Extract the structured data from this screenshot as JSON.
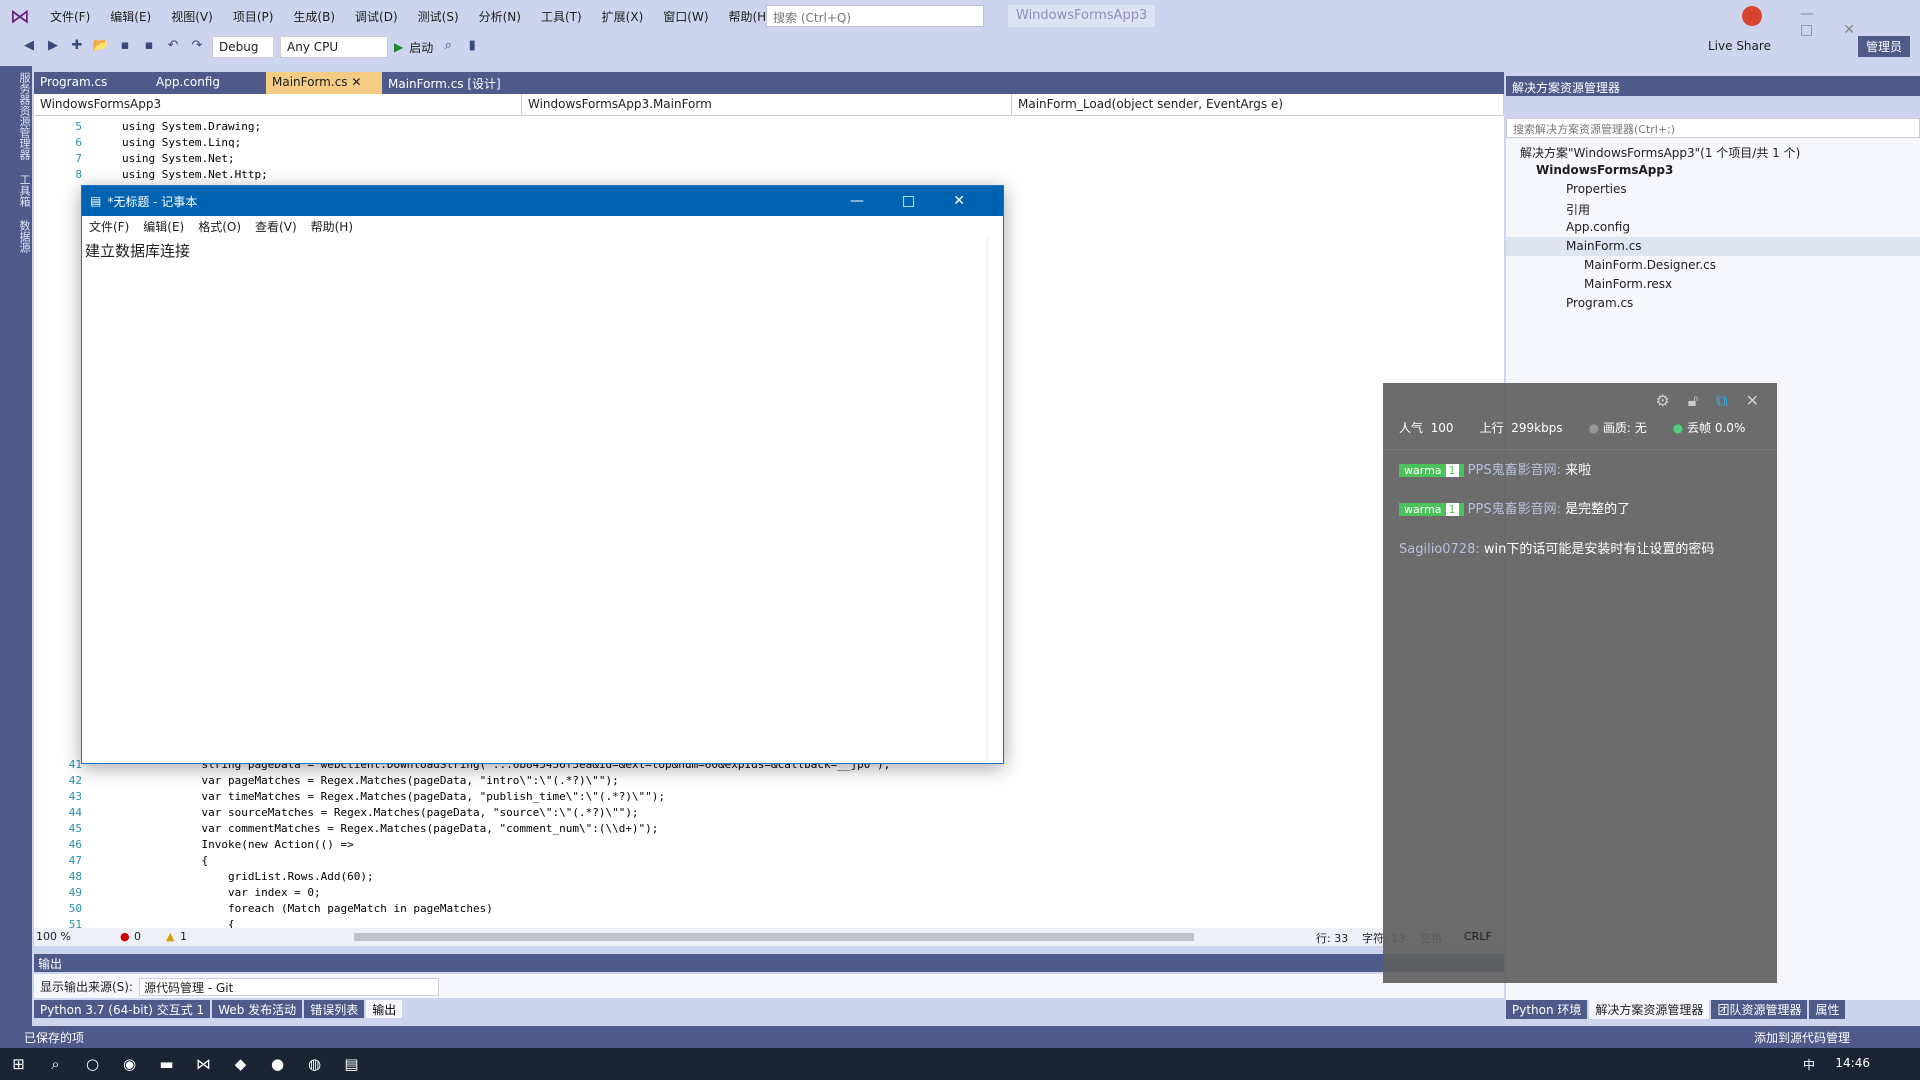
{
  "menu": [
    "文件(F)",
    "编辑(E)",
    "视图(V)",
    "项目(P)",
    "生成(B)",
    "调试(D)",
    "测试(S)",
    "分析(N)",
    "工具(T)",
    "扩展(X)",
    "窗口(W)",
    "帮助(H)"
  ],
  "search_placeholder": "搜索 (Ctrl+Q)",
  "app_title": "WindowsFormsApp3",
  "live_share": "Live Share",
  "admin": "管理员",
  "toolbar": {
    "config": "Debug",
    "platform": "Any CPU",
    "start": "启动"
  },
  "left_sidebar": [
    "服务器资源管理器",
    "工具箱",
    "数据源"
  ],
  "tabs": [
    "Program.cs",
    "App.config",
    "MainForm.cs",
    "MainForm.cs [设计]"
  ],
  "nav": {
    "project": "WindowsFormsApp3",
    "class": "WindowsFormsApp3.MainForm",
    "member": "MainForm_Load(object sender, EventArgs e)"
  },
  "code_top": [
    [
      "5",
      "using System.Drawing;"
    ],
    [
      "6",
      "using System.Linq;"
    ],
    [
      "7",
      "using System.Net;"
    ],
    [
      "8",
      "using System.Net.Http;"
    ]
  ],
  "code_bottom": [
    [
      "41",
      "            string pageData = webClient.DownloadString(\"...6b845456f3ea&id=&ext=top&num=60&expIds=&callback=__jp0\");"
    ],
    [
      "42",
      "            var pageMatches = Regex.Matches(pageData, \"intro\\\":\\\"(.*?)\\\"\");"
    ],
    [
      "43",
      "            var timeMatches = Regex.Matches(pageData, \"publish_time\\\":\\\"(.*?)\\\"\");"
    ],
    [
      "44",
      "            var sourceMatches = Regex.Matches(pageData, \"source\\\":\\\"(.*?)\\\"\");"
    ],
    [
      "45",
      "            var commentMatches = Regex.Matches(pageData, \"comment_num\\\":(\\\\d+)\");"
    ],
    [
      "46",
      "            Invoke(new Action(() =>"
    ],
    [
      "47",
      "            {"
    ],
    [
      "48",
      "                gridList.Rows.Add(60);"
    ],
    [
      "49",
      "                var index = 0;"
    ],
    [
      "50",
      "                foreach (Match pageMatch in pageMatches)"
    ],
    [
      "51",
      "                {"
    ]
  ],
  "editor_status": {
    "zoom": "100 %",
    "errors": "0",
    "warnings": "1",
    "line": "行: 33",
    "char": "字符: 13",
    "spaces": "空格",
    "eol": "CRLF"
  },
  "notepad": {
    "title": "*无标题 - 记事本",
    "menu": [
      "文件(F)",
      "编辑(E)",
      "格式(O)",
      "查看(V)",
      "帮助(H)"
    ],
    "text": "建立数据库连接"
  },
  "solution_explorer": {
    "title": "解决方案资源管理器",
    "search": "搜索解决方案资源管理器(Ctrl+;)",
    "items": [
      "解决方案\"WindowsFormsApp3\"(1 个项目/共 1 个)",
      "WindowsFormsApp3",
      "Properties",
      "引用",
      "App.config",
      "MainForm.cs",
      "MainForm.Designer.cs",
      "MainForm.resx",
      "Program.cs"
    ]
  },
  "danmu": {
    "popularity_label": "人气",
    "popularity": "100",
    "upload_label": "上行",
    "upload": "299kbps",
    "quality": "画质: 无",
    "dropped": "丢帧 0.0%",
    "messages": [
      {
        "badge": "warma",
        "level": "1",
        "user": "PPS鬼畜影音网:",
        "text": "来啦"
      },
      {
        "badge": "warma",
        "level": "1",
        "user": "PPS鬼畜影音网:",
        "text": "是完整的了"
      },
      {
        "user": "Sagilio0728:",
        "text": "win下的话可能是安装时有让设置的密码"
      }
    ]
  },
  "output": {
    "title": "输出",
    "source_label": "显示输出来源(S):",
    "source": "源代码管理 - Git"
  },
  "bottom_tabs": [
    "Python 3.7 (64-bit) 交互式 1",
    "Web 发布活动",
    "错误列表",
    "输出"
  ],
  "right_tabs": [
    "Python 环境",
    "解决方案资源管理器",
    "团队资源管理器",
    "属性"
  ],
  "status": {
    "left": "已保存的项",
    "right": "添加到源代码管理"
  },
  "taskbar": {
    "ime": "中",
    "time": "14:46"
  }
}
